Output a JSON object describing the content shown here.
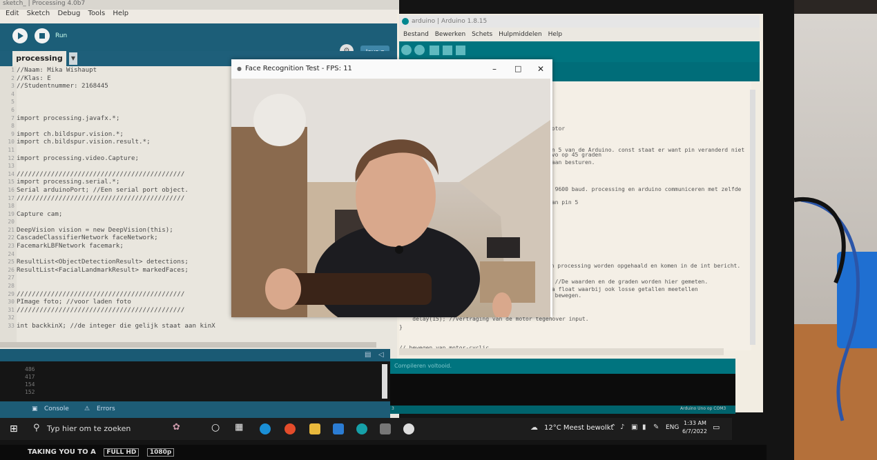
{
  "processing": {
    "title": "sketch_ | Processing 4.0b7",
    "menu": [
      "Edit",
      "Sketch",
      "Debug",
      "Tools",
      "Help"
    ],
    "run_label": "Run",
    "tab": "processing",
    "mode": "Java",
    "code": [
      {
        "n": "1",
        "t": "//Naam: Mika Wishaupt"
      },
      {
        "n": "2",
        "t": "//Klas: E"
      },
      {
        "n": "3",
        "t": "//Studentnummer: 2168445"
      },
      {
        "n": "4",
        "t": ""
      },
      {
        "n": "5",
        "t": ""
      },
      {
        "n": "6",
        "t": ""
      },
      {
        "n": "7",
        "t": "import processing.javafx.*;"
      },
      {
        "n": "8",
        "t": ""
      },
      {
        "n": "9",
        "t": "import ch.bildspur.vision.*;"
      },
      {
        "n": "10",
        "t": "import ch.bildspur.vision.result.*;"
      },
      {
        "n": "11",
        "t": ""
      },
      {
        "n": "12",
        "t": "import processing.video.Capture;"
      },
      {
        "n": "13",
        "t": ""
      },
      {
        "n": "14",
        "t": "////////////////////////////////////////////"
      },
      {
        "n": "15",
        "t": "import processing.serial.*;"
      },
      {
        "n": "16",
        "t": "Serial arduinoPort; //Een serial port object."
      },
      {
        "n": "17",
        "t": "////////////////////////////////////////////"
      },
      {
        "n": "18",
        "t": ""
      },
      {
        "n": "19",
        "t": "Capture cam;"
      },
      {
        "n": "20",
        "t": ""
      },
      {
        "n": "21",
        "t": "DeepVision vision = new DeepVision(this);"
      },
      {
        "n": "22",
        "t": "CascadeClassifierNetwork faceNetwork;"
      },
      {
        "n": "23",
        "t": "FacemarkLBFNetwork facemark;"
      },
      {
        "n": "24",
        "t": ""
      },
      {
        "n": "25",
        "t": "ResultList<ObjectDetectionResult> detections;"
      },
      {
        "n": "26",
        "t": "ResultList<FacialLandmarkResult> markedFaces;"
      },
      {
        "n": "27",
        "t": ""
      },
      {
        "n": "28",
        "t": ""
      },
      {
        "n": "29",
        "t": "////////////////////////////////////////////"
      },
      {
        "n": "30",
        "t": "PImage foto; //voor laden foto"
      },
      {
        "n": "31",
        "t": "////////////////////////////////////////////"
      },
      {
        "n": "32",
        "t": ""
      },
      {
        "n": "33",
        "t": "int backkinX; //de integer die gelijk staat aan kinX"
      }
    ],
    "console_lines": [
      "486",
      "417",
      "154",
      "152"
    ],
    "console_tab": "Console",
    "errors_tab": "Errors"
  },
  "arduino": {
    "title": "arduino | Arduino 1.8.15",
    "menu": [
      "Bestand",
      "Bewerken",
      "Schets",
      "Hulpmiddelen",
      "Help"
    ],
    "code": [
      "motor",
      "in 5 van de Arduino. const staat er want pin veranderd niet",
      "rvo op 45 graden",
      "gaan besturen.",
      "n 9600 baud. processing en arduino communiceren met zelfde",
      "aan pin 5",
      "van processing worden opgehaald en komen in de int bericht.",
      ": //De waarden en de graden worden hier gemeten.",
      "ia float waarbij ook losse getallen meetellen",
      "t bewegen.",
      "}",
      "    delay(15); //vertraging van de motor tegenover input.",
      "}",
      "// bewegen van motor-cyclic"
    ],
    "status": "Compileren voltooid.",
    "board": "Arduino Uno op COM3",
    "line_no": "3"
  },
  "face_window": {
    "title": "Face Recognition Test - FPS: 11"
  },
  "taskbar": {
    "search_placeholder": "Typ hier om te zoeken",
    "weather": "12°C  Meest bewolkt",
    "lang": "ENG",
    "time": "1:33 AM",
    "date": "6/7/2022"
  },
  "sticker": {
    "text": "TAKING YOU TO A",
    "badge1": "FULL HD",
    "badge2": "1080p"
  }
}
